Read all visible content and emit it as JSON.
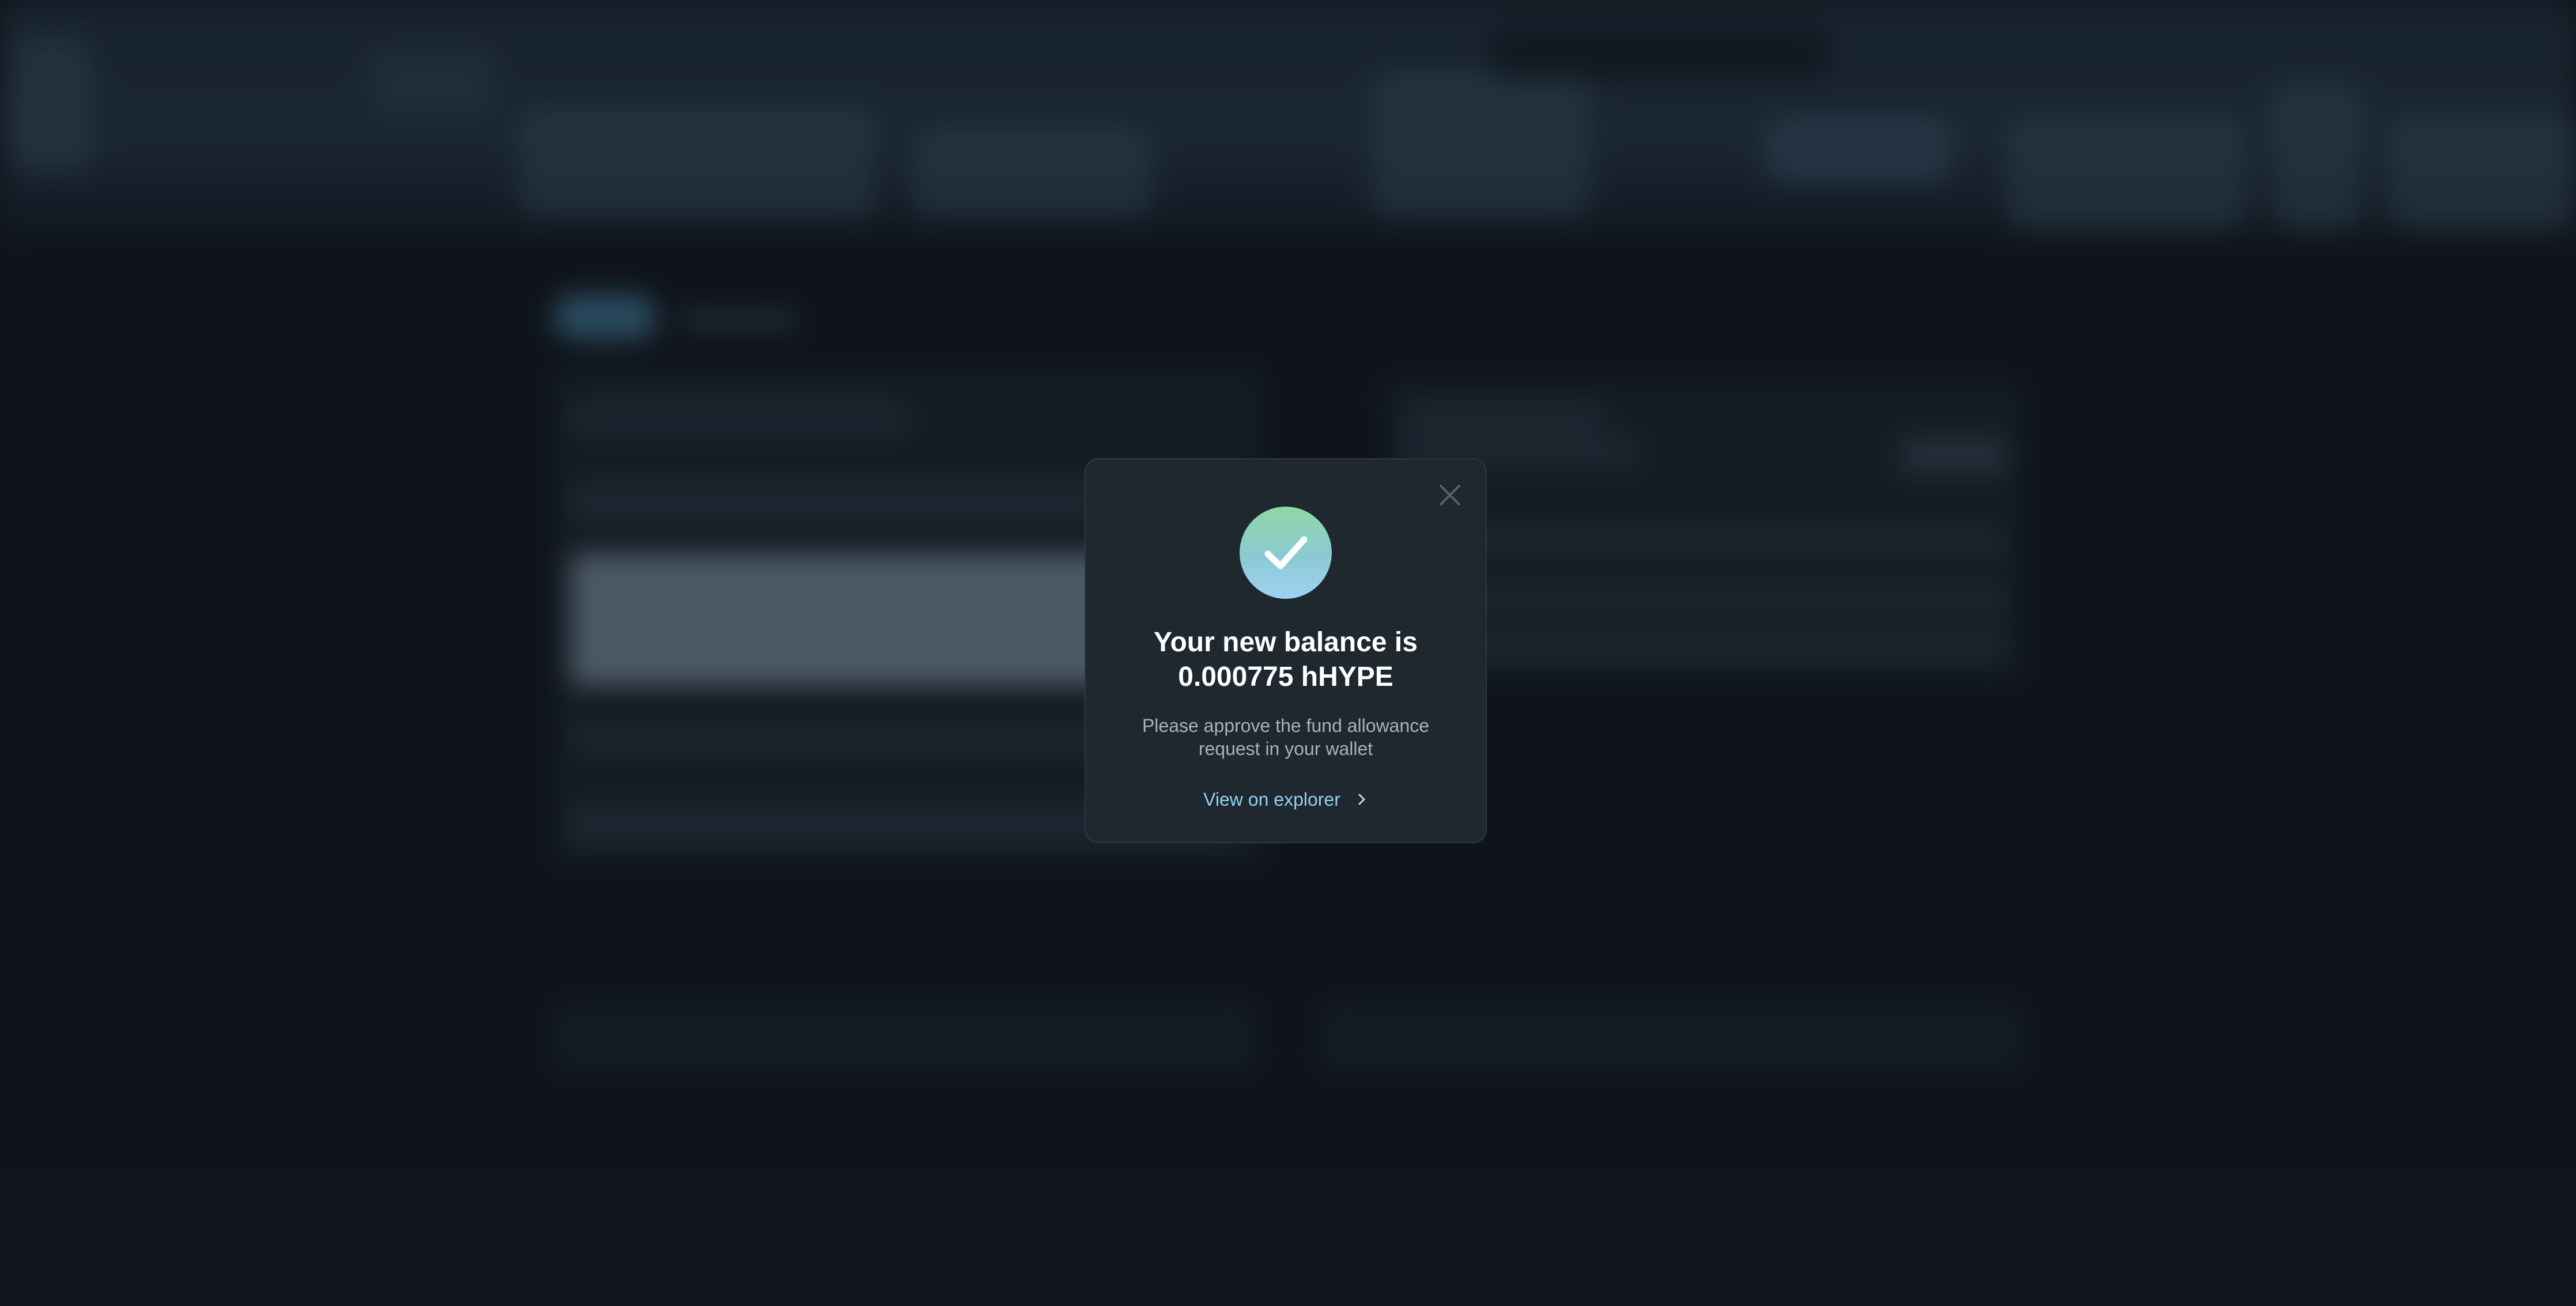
{
  "dialog": {
    "title": "Your new balance is 0.000775 hHYPE",
    "message": "Please approve the fund allowance request in your wallet",
    "link_label": "View on explorer",
    "icons": {
      "status": "check-circle-icon",
      "close": "close-icon",
      "link": "chevron-right-icon"
    },
    "colors": {
      "background": "#1f272f",
      "title": "#ffffff",
      "message": "#a8b2bc",
      "link": "#8fd3f0",
      "success_gradient_top": "#8ed8a6",
      "success_gradient_bottom": "#9fd2f2"
    }
  },
  "backdrop": {
    "state": "blurred",
    "color": "#13181f"
  }
}
